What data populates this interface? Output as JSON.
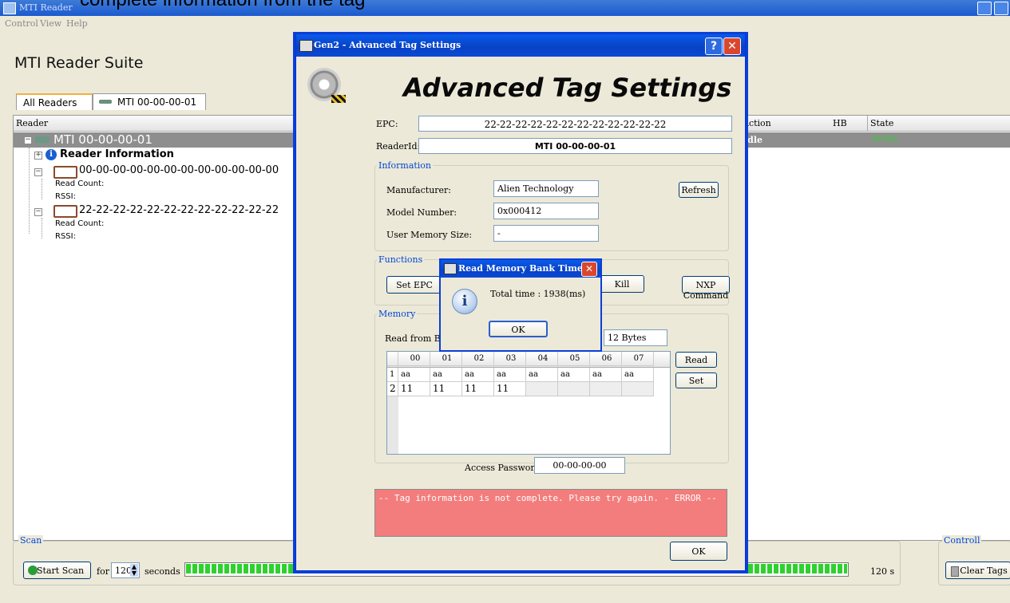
{
  "overlay_caption": "complete information from the tag",
  "main": {
    "window_title": "MTI Reader",
    "menu": [
      "Control",
      "View",
      "Help"
    ],
    "suite_title": "MTI Reader Suite",
    "tabs": [
      "All Readers",
      "MTI 00-00-00-01"
    ],
    "columns": {
      "reader": "Reader",
      "action": "Action",
      "hb": "HB",
      "state": "State"
    },
    "reader_row": {
      "name": "MTI 00-00-00-01",
      "action": "Idle",
      "state": "Online"
    },
    "tree": {
      "reader_info": "Reader Information",
      "tags": [
        {
          "epc": "00-00-00-00-00-00-00-00-00-00-00-00",
          "read_count": "Read Count:",
          "rssi": "RSSI:"
        },
        {
          "epc": "22-22-22-22-22-22-22-22-22-22-22-22",
          "read_count": "Read Count:",
          "rssi": "RSSI:"
        }
      ]
    },
    "scan": {
      "group": "Scan",
      "start_button": "Start Scan",
      "for": "for",
      "seconds_value": "120",
      "seconds_label": "seconds",
      "remaining": "120 s"
    },
    "control": {
      "group": "Controll",
      "clear_button": "Clear Tags"
    }
  },
  "dialog": {
    "title": "Gen2 - Advanced Tag Settings",
    "heading": "Advanced Tag Settings",
    "epc_label": "EPC:",
    "epc_value": "22-22-22-22-22-22-22-22-22-22-22-22",
    "readerid_label": "ReaderId:",
    "readerid_value": "MTI 00-00-00-01",
    "information": {
      "group": "Information",
      "manufacturer_label": "Manufacturer:",
      "manufacturer_value": "Alien Technology",
      "model_label": "Model Number:",
      "model_value": "0x000412",
      "memsize_label": "User Memory Size:",
      "memsize_value": "-",
      "refresh": "Refresh"
    },
    "functions": {
      "group": "Functions",
      "set_epc": "Set EPC",
      "kill": "Kill",
      "nxp": "NXP Command"
    },
    "memory": {
      "group": "Memory",
      "read_from_label": "Read from Ba",
      "bytes_value": "12 Bytes",
      "columns": [
        "00",
        "01",
        "02",
        "03",
        "04",
        "05",
        "06",
        "07"
      ],
      "rows": [
        {
          "num": "1",
          "cells": [
            "aa",
            "aa",
            "aa",
            "aa",
            "aa",
            "aa",
            "aa",
            "aa"
          ]
        },
        {
          "num": "2",
          "cells": [
            "11",
            "11",
            "11",
            "11",
            "",
            "",
            "",
            ""
          ]
        }
      ],
      "read_button": "Read",
      "set_button": "Set",
      "password_label": "Access Password:",
      "password_value": "00-00-00-00"
    },
    "error_text": "-- Tag information is not complete. Please try again. - ERROR --",
    "ok": "OK"
  },
  "popup": {
    "title": "Read Memory Bank Time",
    "message": "Total time : 1938(ms)",
    "ok": "OK"
  },
  "colors": {
    "title_blue": "#0a48d6",
    "error_bg": "#f37d7d",
    "online_green": "#2fd12f",
    "tag_border": "#8b4a2b"
  }
}
